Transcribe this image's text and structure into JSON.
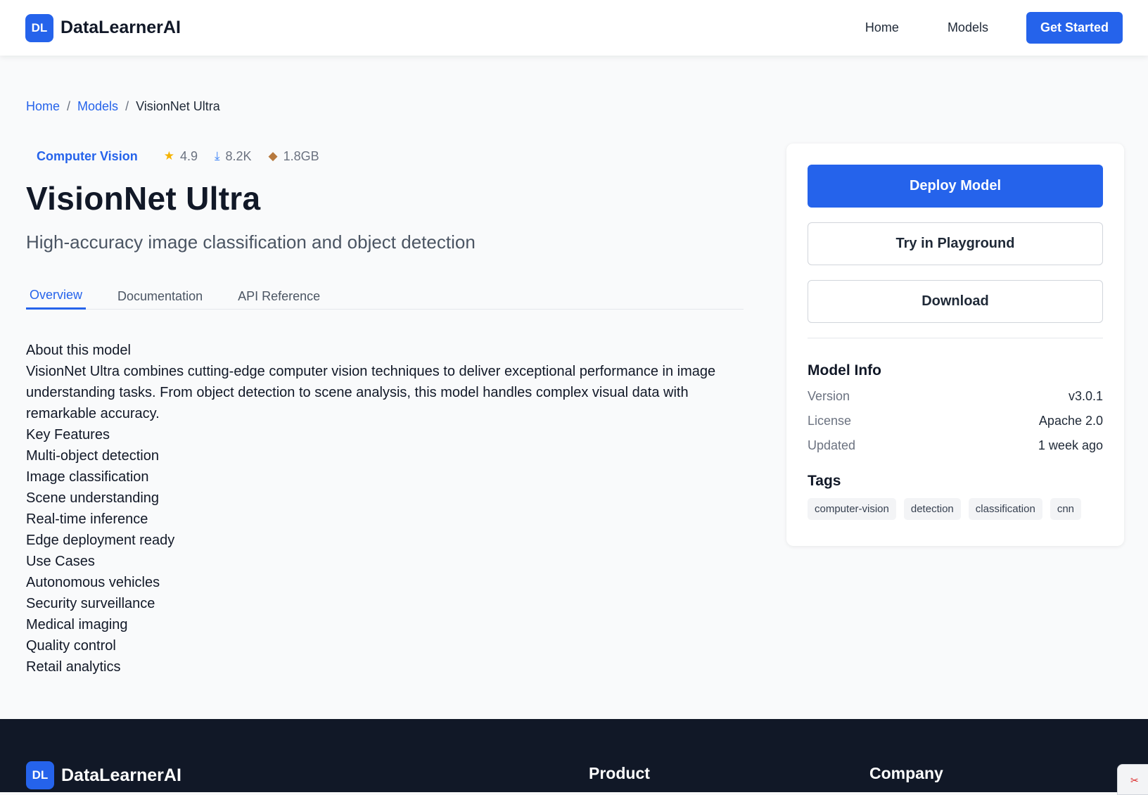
{
  "nav": {
    "logo_text": "DL",
    "brand": "DataLearnerAI",
    "links": [
      "Home",
      "Models"
    ],
    "cta": "Get Started"
  },
  "breadcrumb": {
    "items": [
      "Home",
      "Models"
    ],
    "separator": "/",
    "current": "VisionNet Ultra"
  },
  "model": {
    "category": "Computer Vision",
    "rating": "4.9",
    "downloads": "8.2K",
    "size": "1.8GB",
    "icons": {
      "rating": "star-icon",
      "downloads": "download-tray-icon",
      "size": "package-icon"
    },
    "title": "VisionNet Ultra",
    "subtitle": "High-accuracy image classification and object detection"
  },
  "tabs": [
    {
      "label": "Overview",
      "active": true
    },
    {
      "label": "Documentation",
      "active": false
    },
    {
      "label": "API Reference",
      "active": false
    }
  ],
  "content": {
    "about_heading": "About this model",
    "about_text": "VisionNet Ultra combines cutting-edge computer vision techniques to deliver exceptional performance in image understanding tasks. From object detection to scene analysis, this model handles complex visual data with remarkable accuracy.",
    "features_heading": "Key Features",
    "features": [
      "Multi-object detection",
      "Image classification",
      "Scene understanding",
      "Real-time inference",
      "Edge deployment ready"
    ],
    "usecases_heading": "Use Cases",
    "usecases": [
      "Autonomous vehicles",
      "Security surveillance",
      "Medical imaging",
      "Quality control",
      "Retail analytics"
    ]
  },
  "sidebar": {
    "deploy_label": "Deploy Model",
    "playground_label": "Try in Playground",
    "download_label": "Download",
    "info_heading": "Model Info",
    "info": [
      {
        "key": "Version",
        "value": "v3.0.1"
      },
      {
        "key": "License",
        "value": "Apache 2.0"
      },
      {
        "key": "Updated",
        "value": "1 week ago"
      }
    ],
    "tags_heading": "Tags",
    "tags": [
      "computer-vision",
      "detection",
      "classification",
      "cnn"
    ]
  },
  "footer": {
    "logo_text": "DL",
    "brand": "DataLearnerAI",
    "product_heading": "Product",
    "company_heading": "Company"
  },
  "colors": {
    "accent": "#2563eb",
    "footer_bg": "#111827",
    "page_bg": "#f9fafb"
  }
}
